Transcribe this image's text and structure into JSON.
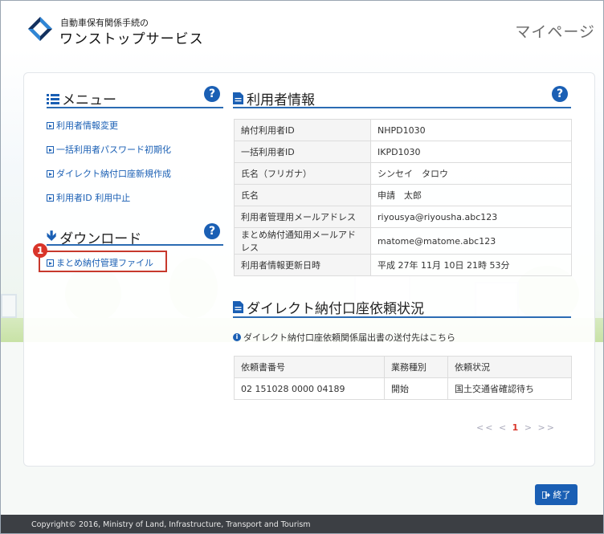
{
  "header": {
    "logo_small": "自動車保有関係手続の",
    "logo_big": "ワンストップサービス",
    "mypage": "マイページ"
  },
  "menu": {
    "title": "メニュー",
    "help": "?",
    "items": [
      {
        "label": "利用者情報変更"
      },
      {
        "label": "一括利用者パスワード初期化"
      },
      {
        "label": "ダイレクト納付口座新規作成"
      },
      {
        "label": "利用者ID 利用中止"
      }
    ]
  },
  "download": {
    "title": "ダウンロード",
    "help": "?",
    "items": [
      {
        "label": "まとめ納付管理ファイル"
      }
    ],
    "badge": "1"
  },
  "user_info": {
    "title": "利用者情報",
    "help": "?",
    "rows": [
      {
        "key": "納付利用者ID",
        "value": "NHPD1030"
      },
      {
        "key": "一括利用者ID",
        "value": "IKPD1030"
      },
      {
        "key": "氏名（フリガナ）",
        "value": "シンセイ　タロウ"
      },
      {
        "key": "氏名",
        "value": "申請　太郎"
      },
      {
        "key": "利用者管理用メールアドレス",
        "value": "riyousya@riyousha.abc123"
      },
      {
        "key": "まとめ納付通知用メールアドレス",
        "value": "matome@matome.abc123"
      },
      {
        "key": "利用者情報更新日時",
        "value": "平成 27年 11月 10日 21時 53分"
      }
    ]
  },
  "direct": {
    "title": "ダイレクト納付口座依頼状況",
    "notice": "ダイレクト納付口座依頼関係届出書の送付先はこちら",
    "headers": [
      "依頼書番号",
      "業務種別",
      "依頼状況"
    ],
    "rows": [
      {
        "c1": "02 151028 0000 04189",
        "c2": "開始",
        "c3": "国土交通省確認待ち"
      }
    ],
    "pager": {
      "first": "<<",
      "prev": "<",
      "current": "1",
      "next": ">",
      "last": ">>"
    }
  },
  "exit_label": "終了",
  "footer": "Copyright© 2016, Ministry of Land, Infrastructure, Transport and Tourism",
  "colors": {
    "accent": "#1a5fb4",
    "highlight": "#c7392c",
    "footer_bg": "#3c3f44"
  }
}
